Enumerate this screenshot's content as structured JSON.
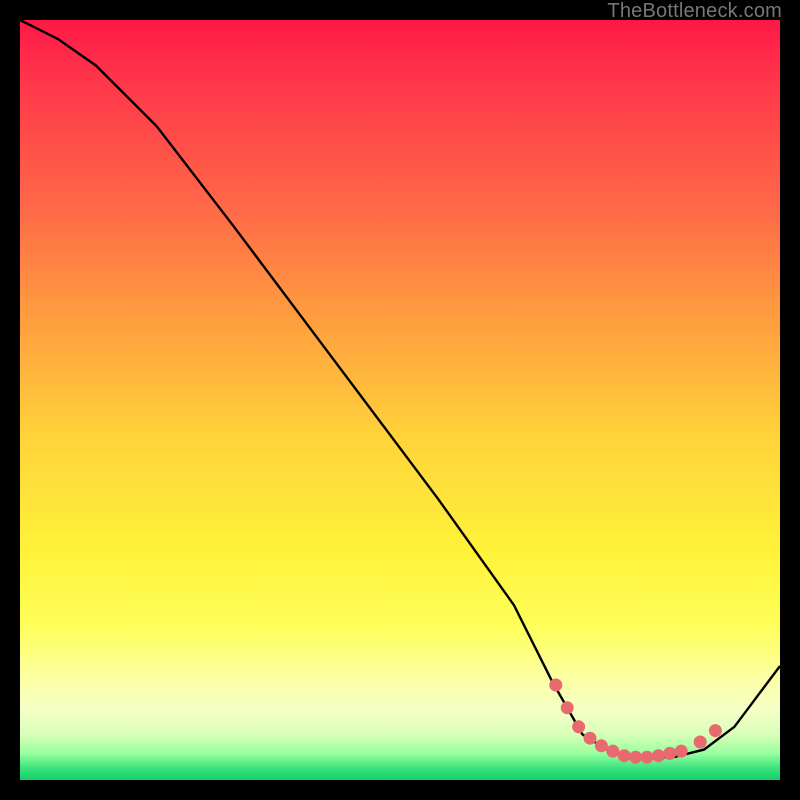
{
  "watermark": "TheBottleneck.com",
  "chart_data": {
    "type": "line",
    "title": "",
    "xlabel": "",
    "ylabel": "",
    "xlim": [
      0,
      100
    ],
    "ylim": [
      0,
      100
    ],
    "series": [
      {
        "name": "curve",
        "x": [
          0,
          5,
          10,
          18,
          28,
          40,
          55,
          65,
          70,
          74,
          78,
          82,
          86,
          90,
          94,
          100
        ],
        "y": [
          100,
          97.5,
          94,
          86,
          73,
          57,
          37,
          23,
          13,
          6,
          3.5,
          3,
          3,
          4,
          7,
          15
        ]
      }
    ],
    "markers": {
      "name": "dots",
      "x": [
        70.5,
        72,
        73.5,
        75,
        76.5,
        78,
        79.5,
        81,
        82.5,
        84,
        85.5,
        87,
        89.5,
        91.5
      ],
      "y": [
        12.5,
        9.5,
        7,
        5.5,
        4.5,
        3.8,
        3.2,
        3,
        3,
        3.2,
        3.5,
        3.8,
        5,
        6.5
      ]
    },
    "colors": {
      "curve": "#000000",
      "marker": "#e86a6f"
    }
  }
}
